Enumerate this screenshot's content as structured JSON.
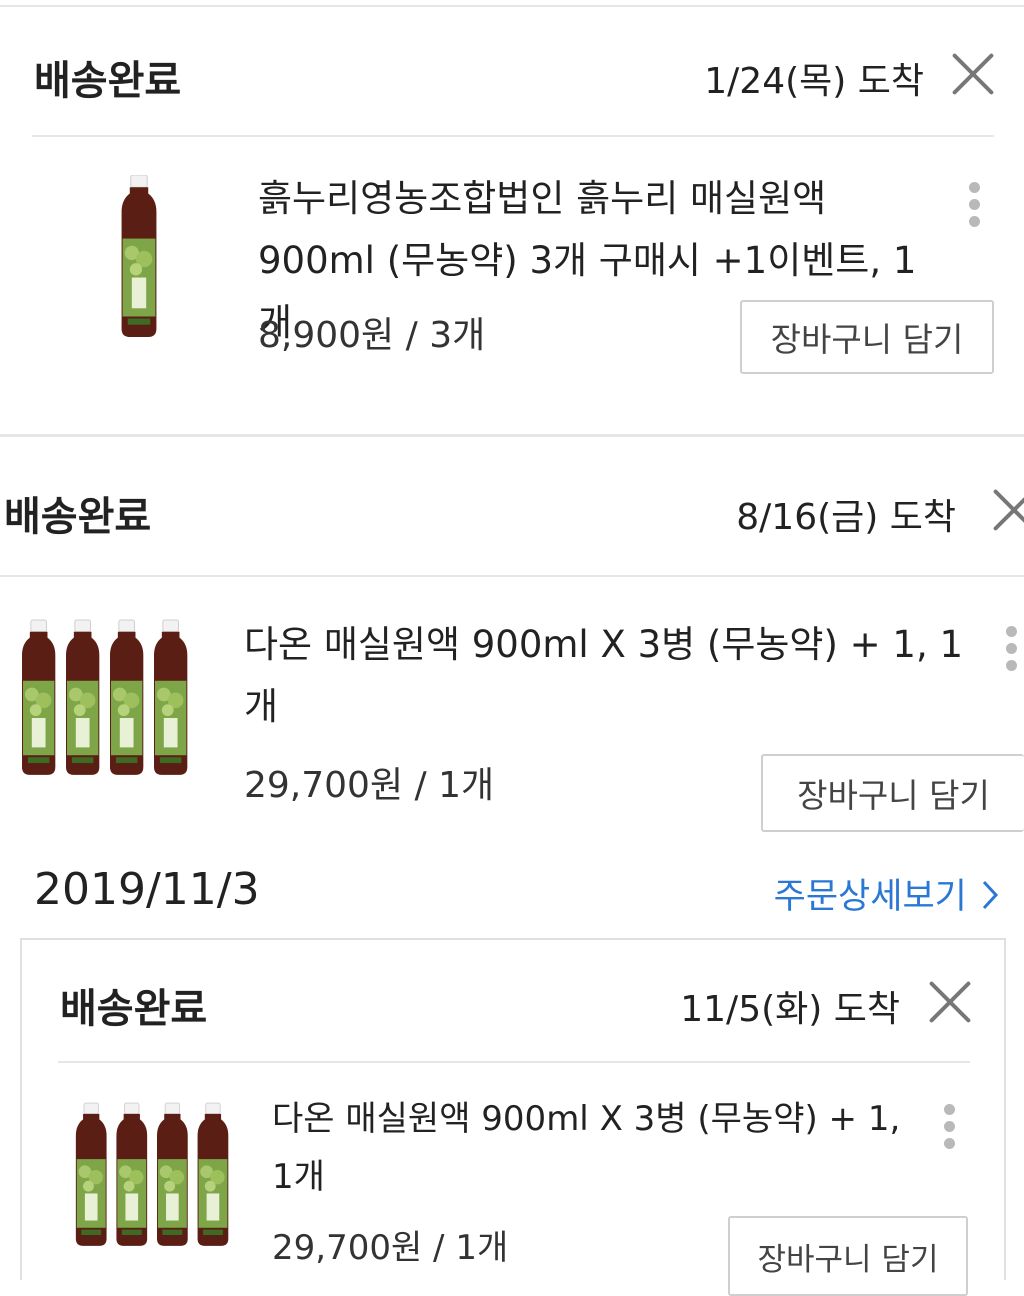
{
  "orders": [
    {
      "status": "배송완료",
      "arrival": "1/24(목) 도착",
      "product_name": "흙누리영농조합법인 흙누리 매실원액 900ml (무농약) 3개 구매시 +1이벤트, 1개",
      "price": "8,900원 / 3개",
      "cart_label": "장바구니 담기",
      "thumbnail": "single-bottle"
    },
    {
      "status": "배송완료",
      "arrival": "8/16(금) 도착",
      "product_name": "다온 매실원액 900ml X 3병 (무농약) + 1, 1개",
      "price": "29,700원 / 1개",
      "cart_label": "장바구니 담기",
      "thumbnail": "four-bottles"
    }
  ],
  "order_group": {
    "date": "2019/11/3",
    "detail_link": "주문상세보기",
    "detail_icon": "chevron-right-icon",
    "status": "배송완료",
    "arrival": "11/5(화) 도착",
    "product_name": "다온 매실원액 900ml X 3병 (무농약) + 1, 1개",
    "price": "29,700원 / 1개",
    "cart_label": "장바구니 담기",
    "thumbnail": "four-bottles"
  },
  "colors": {
    "link_blue": "#2a78d4",
    "divider": "#e6e6e6",
    "bottle_liquid": "#5a1e14",
    "label_green": "#6f9a3c"
  }
}
